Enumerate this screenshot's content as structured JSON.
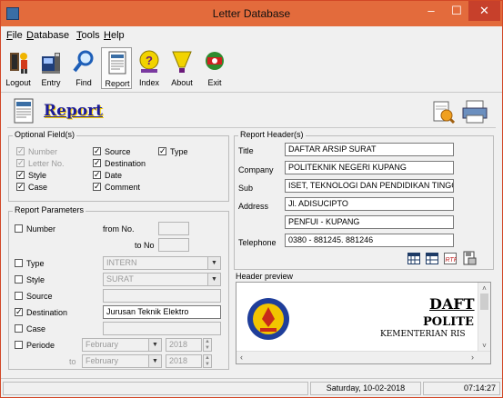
{
  "window": {
    "title": "Letter Database",
    "controls": {
      "minimize": "–",
      "maximize": "☐",
      "close": "✕"
    }
  },
  "menu": [
    {
      "key": "F",
      "rest": "ile"
    },
    {
      "key": "D",
      "rest": "atabase"
    },
    {
      "key": "T",
      "rest": "ools"
    },
    {
      "key": "H",
      "rest": "elp"
    }
  ],
  "toolbar": [
    {
      "label": "Logout",
      "icon": "logout-icon"
    },
    {
      "label": "Entry",
      "icon": "entry-icon"
    },
    {
      "label": "Find",
      "icon": "find-icon"
    },
    {
      "label": "Report",
      "icon": "report-icon"
    },
    {
      "label": "Index",
      "icon": "index-icon"
    },
    {
      "label": "About",
      "icon": "about-icon"
    },
    {
      "label": "Exit",
      "icon": "exit-icon"
    }
  ],
  "report": {
    "title": "Report"
  },
  "optional_fields": {
    "label": "Optional Field(s)",
    "items": [
      {
        "label": "Number",
        "checked": true,
        "disabled": true
      },
      {
        "label": "Letter No.",
        "checked": true,
        "disabled": true
      },
      {
        "label": "Style",
        "checked": true,
        "disabled": false
      },
      {
        "label": "Case",
        "checked": true,
        "disabled": false
      },
      {
        "label": "Source",
        "checked": true,
        "disabled": false
      },
      {
        "label": "Destination",
        "checked": true,
        "disabled": false
      },
      {
        "label": "Date",
        "checked": true,
        "disabled": false
      },
      {
        "label": "Comment",
        "checked": true,
        "disabled": false
      },
      {
        "label": "Type",
        "checked": true,
        "disabled": false
      }
    ]
  },
  "report_parameters": {
    "label": "Report Parameters",
    "number": {
      "label": "Number",
      "checked": false,
      "from_label": "from No.",
      "to_label": "to No",
      "from_value": "",
      "to_value": ""
    },
    "type": {
      "label": "Type",
      "checked": false,
      "value": "INTERN"
    },
    "style": {
      "label": "Style",
      "checked": false,
      "value": "SURAT"
    },
    "source": {
      "label": "Source",
      "checked": false,
      "value": ""
    },
    "destination": {
      "label": "Destination",
      "checked": true,
      "value": "Jurusan Teknik Elektro"
    },
    "case": {
      "label": "Case",
      "checked": false,
      "value": ""
    },
    "periode": {
      "label": "Periode",
      "checked": false,
      "from_month": "February",
      "from_year": "2018",
      "to_label": "to",
      "to_month": "February",
      "to_year": "2018"
    }
  },
  "report_header": {
    "label": "Report Header(s)",
    "title_label": "Title",
    "title_value": "DAFTAR ARSIP SURAT",
    "company_label": "Company",
    "company_value": "POLITEKNIK NEGERI KUPANG",
    "sub_label": "Sub",
    "sub_value": "ISET, TEKNOLOGI DAN PENDIDIKAN TINGGI",
    "address_label": "Address",
    "address_line1": "Jl. ADISUCIPTO",
    "address_line2": "PENFUI - KUPANG",
    "telephone_label": "Telephone",
    "telephone_value": "0380 - 881245. 881246"
  },
  "header_preview": {
    "label": "Header preview",
    "line1": "DAFT",
    "line2": "POLITE",
    "line3": "KEMENTERIAN RIS"
  },
  "status": {
    "date": "Saturday, 10-02-2018",
    "time": "07:14:27"
  },
  "colors": {
    "titlebar": "#e36b3c",
    "close": "#c7402b",
    "report_title": "#1b1b9a"
  }
}
